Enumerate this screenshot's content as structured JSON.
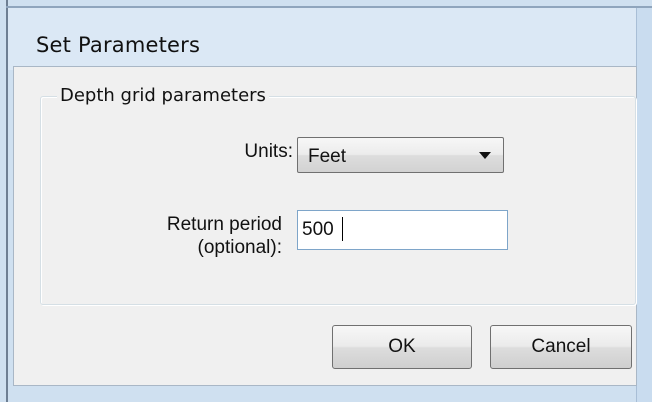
{
  "window": {
    "title": "Set Parameters"
  },
  "group": {
    "label": "Depth grid parameters"
  },
  "units": {
    "label": "Units:",
    "selected": "Feet"
  },
  "return_period": {
    "label_line1": "Return period",
    "label_line2": "(optional):",
    "value": "500"
  },
  "buttons": {
    "ok_label": "OK",
    "cancel_label": "Cancel"
  }
}
